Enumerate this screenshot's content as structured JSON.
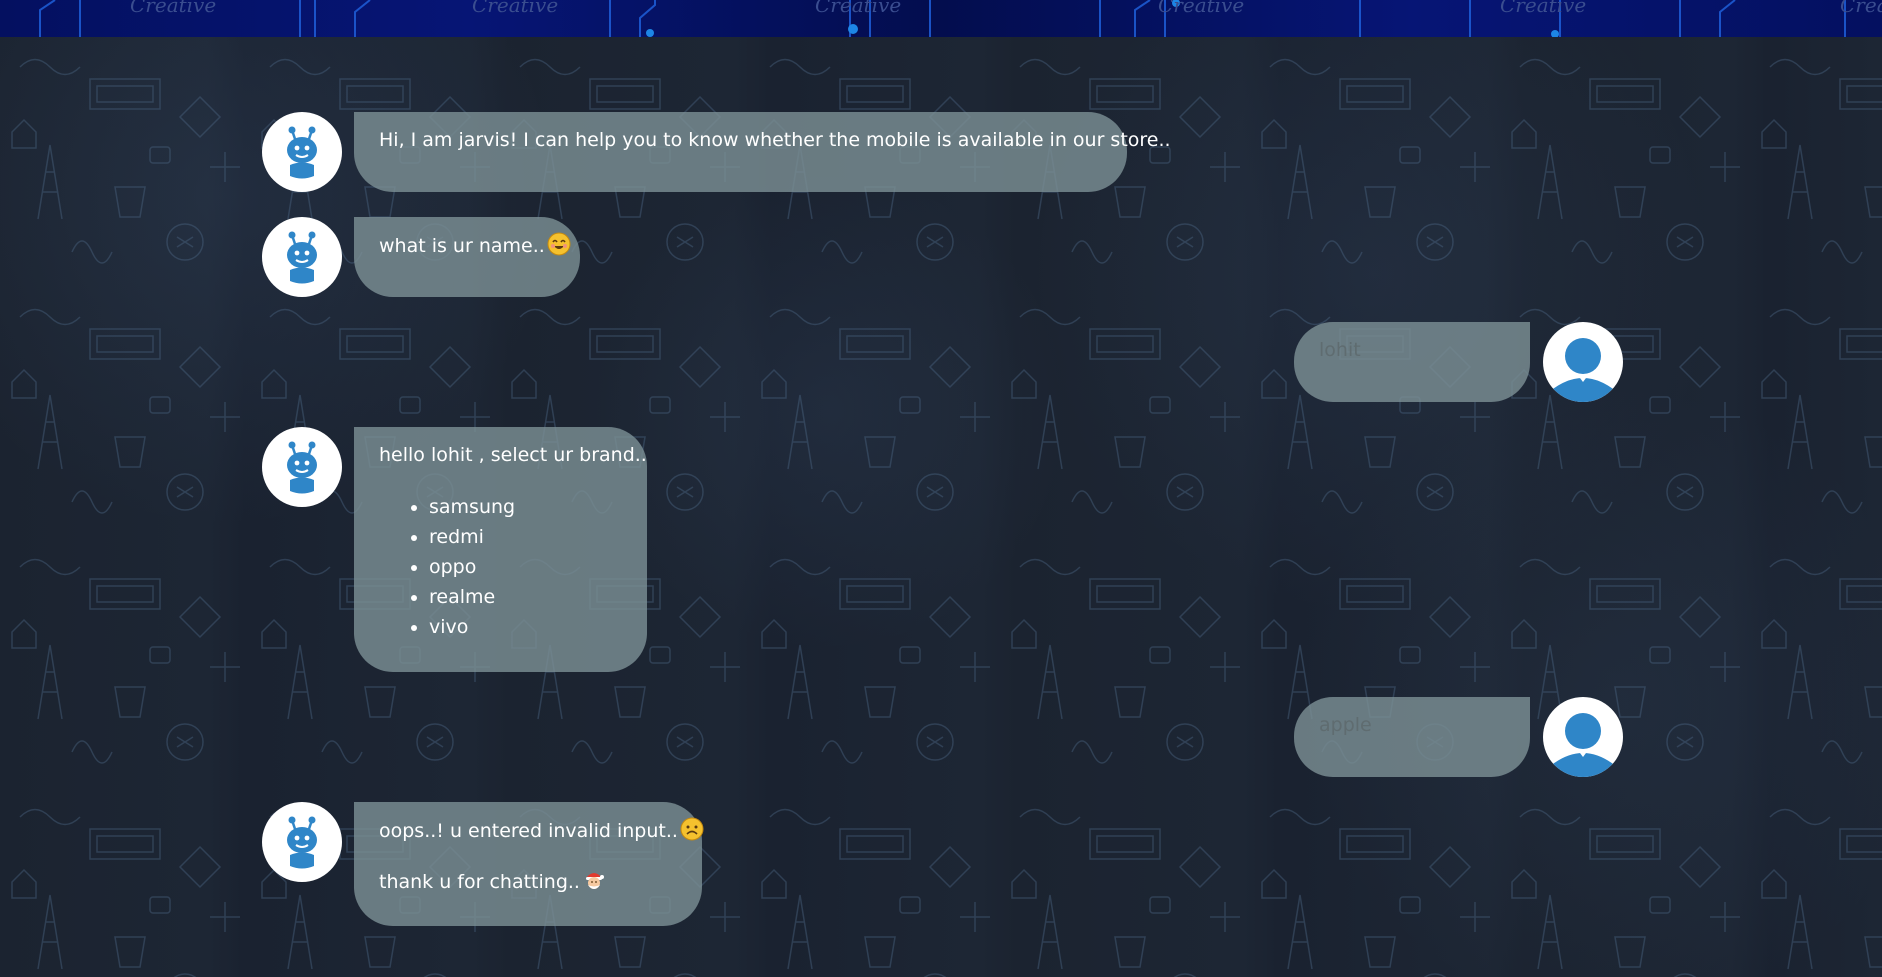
{
  "colors": {
    "banner": "#061575",
    "bubble": "#7d9196",
    "bot_icon": "#2f86c8",
    "user_icon": "#2f86c8",
    "background": "#1d2532"
  },
  "banner": {
    "watermarks": [
      "Creative",
      "Creative",
      "Creative",
      "Creative",
      "Creative",
      "Creative"
    ]
  },
  "messages": [
    {
      "sender": "bot",
      "avatar_icon": "robot-icon",
      "text": "Hi, I am jarvis! I can help you to know whether the mobile is available in our store.."
    },
    {
      "sender": "bot",
      "avatar_icon": "robot-icon",
      "text": "what is ur name..",
      "emoji": "smiling-face-emoji"
    },
    {
      "sender": "user",
      "avatar_icon": "user-icon",
      "text": "lohit"
    },
    {
      "sender": "bot",
      "avatar_icon": "robot-icon",
      "text": "hello lohit , select ur brand..",
      "options": [
        "samsung",
        "redmi",
        "oppo",
        "realme",
        "vivo"
      ]
    },
    {
      "sender": "user",
      "avatar_icon": "user-icon",
      "text": "apple"
    },
    {
      "sender": "bot",
      "avatar_icon": "robot-icon",
      "text": "oops..! u entered invalid input..",
      "emoji": "sad-face-emoji",
      "text2": "thank u for chatting..",
      "emoji2": "santa-face-emoji"
    }
  ]
}
